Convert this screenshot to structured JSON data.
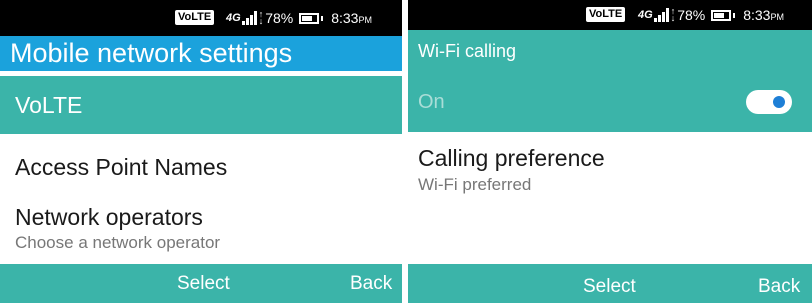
{
  "left_screen": {
    "status_bar": {
      "volte_badge": "VoLTE",
      "network_type": "4G",
      "battery_percent": "78%",
      "time": "8:33",
      "time_suffix": "PM"
    },
    "header_title": "Mobile network settings",
    "menu_items": [
      {
        "title": "VoLTE",
        "subtitle": "",
        "selected": true
      },
      {
        "title": "Access Point Names",
        "subtitle": "",
        "selected": false
      },
      {
        "title": "Network operators",
        "subtitle": "Choose a network operator",
        "selected": false
      }
    ],
    "softkeys": {
      "select": "Select",
      "back": "Back"
    }
  },
  "right_screen": {
    "status_bar": {
      "volte_badge": "VoLTE",
      "network_type": "4G",
      "battery_percent": "78%",
      "time": "8:33",
      "time_suffix": "PM"
    },
    "header_title": "Wi-Fi calling",
    "toggle_row": {
      "label": "On",
      "enabled": true
    },
    "calling_preference": {
      "title": "Calling preference",
      "value": "Wi-Fi preferred"
    },
    "softkeys": {
      "select": "Select",
      "back": "Back"
    }
  },
  "colors": {
    "header_blue": "#1ba2dc",
    "teal_accent": "#3bb4a9",
    "toggle_knob": "#1e7fd6",
    "status_bar_bg": "#000000"
  },
  "icons": [
    "signal-icon",
    "data-arrows-icon",
    "battery-icon",
    "toggle-switch"
  ]
}
